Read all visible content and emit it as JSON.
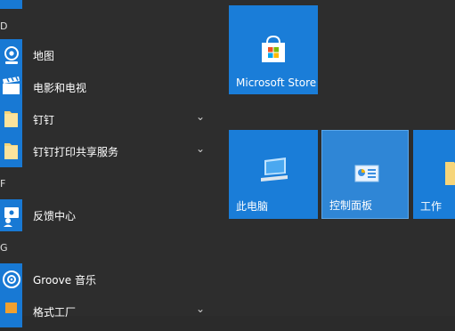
{
  "sections": {
    "d": "D",
    "f": "F",
    "g": "G"
  },
  "apps": [
    {
      "label": "地图",
      "icon": "maps-icon"
    },
    {
      "label": "电影和电视",
      "icon": "movies-tv-icon"
    },
    {
      "label": "钉钉",
      "icon": "folder-icon",
      "expandable": true
    },
    {
      "label": "钉钉打印共享服务",
      "icon": "folder-icon",
      "expandable": true
    },
    {
      "label": "反馈中心",
      "icon": "feedback-hub-icon"
    },
    {
      "label": "Groove 音乐",
      "icon": "groove-music-icon"
    },
    {
      "label": "格式工厂",
      "icon": "format-factory-icon",
      "expandable": true
    }
  ],
  "tiles": {
    "store": "Microsoft Store",
    "this_pc": "此电脑",
    "control_panel": "控制面板",
    "work": "工作"
  },
  "colors": {
    "accent": "#1a7dd8",
    "background": "#2d2d2d"
  }
}
